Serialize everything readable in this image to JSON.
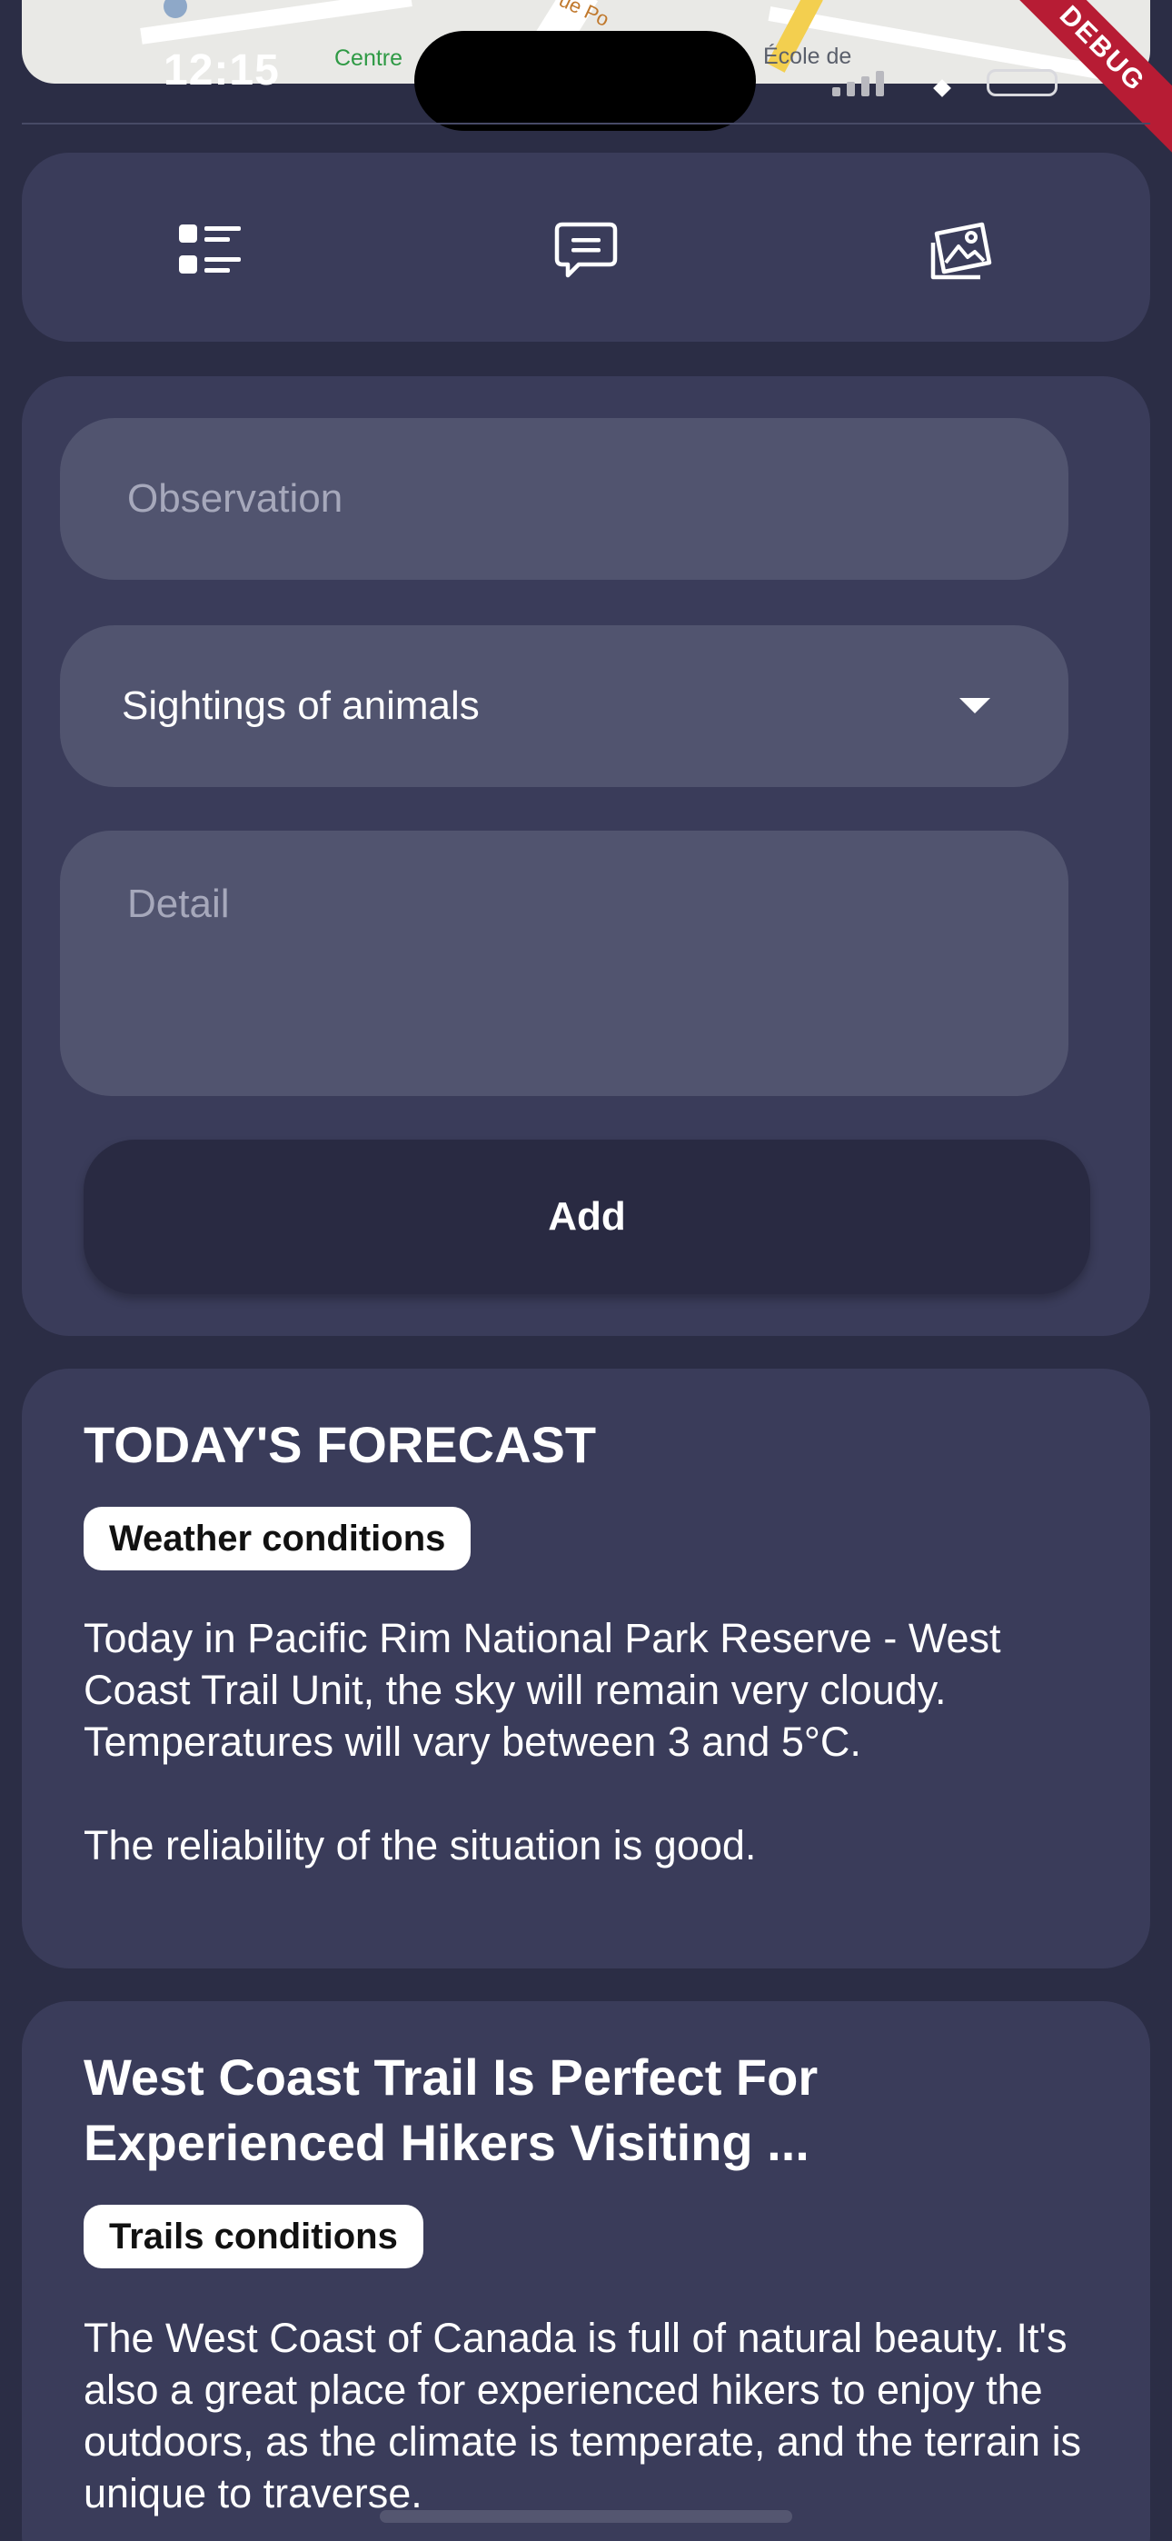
{
  "status_bar": {
    "time": "12:15",
    "debug_label": "DEBUG"
  },
  "map": {
    "labels": {
      "centre": "Centre",
      "ecole": "École de",
      "street": "ue Po"
    }
  },
  "toolbar": {
    "icons": [
      "list-icon",
      "comment-icon",
      "gallery-icon"
    ]
  },
  "form": {
    "observation_placeholder": "Observation",
    "category_value": "Sightings of animals",
    "detail_placeholder": "Detail",
    "add_label": "Add"
  },
  "forecast": {
    "title": "TODAY'S FORECAST",
    "badge": "Weather conditions",
    "body": "Today in Pacific Rim National Park Reserve - West Coast Trail Unit, the sky will remain very cloudy.\nTemperatures will vary between 3 and 5°C.\n\nThe reliability of the situation is good."
  },
  "news": {
    "title": "West Coast Trail Is Perfect For Experienced Hikers Visiting ...",
    "badge": "Trails conditions",
    "body": "The West Coast of Canada is full of natural beauty. It's also a great place for experienced hikers to enjoy the outdoors, as the climate is temperate, and the terrain is unique to traverse."
  },
  "colors": {
    "background": "#2b2d45",
    "card": "#3a3c5a",
    "field": "#51546f",
    "button": "#292a42",
    "badge": "#ffffff",
    "debug": "#b71c34"
  }
}
